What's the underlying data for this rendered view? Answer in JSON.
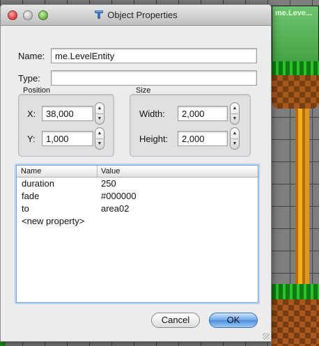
{
  "window": {
    "title": "Object Properties"
  },
  "scene": {
    "tile_label": "me.Leve..."
  },
  "form": {
    "name_label": "Name:",
    "name_value": "me.LevelEntity",
    "type_label": "Type:",
    "type_value": ""
  },
  "position": {
    "title": "Position",
    "x_label": "X:",
    "x_value": "38,000",
    "y_label": "Y:",
    "y_value": "1,000"
  },
  "size": {
    "title": "Size",
    "width_label": "Width:",
    "width_value": "2,000",
    "height_label": "Height:",
    "height_value": "2,000"
  },
  "properties": {
    "headers": {
      "name": "Name",
      "value": "Value"
    },
    "rows": [
      {
        "name": "duration",
        "value": "250"
      },
      {
        "name": "fade",
        "value": "#000000"
      },
      {
        "name": "to",
        "value": "area02"
      },
      {
        "name": "<new property>",
        "value": ""
      }
    ]
  },
  "buttons": {
    "cancel": "Cancel",
    "ok": "OK"
  }
}
